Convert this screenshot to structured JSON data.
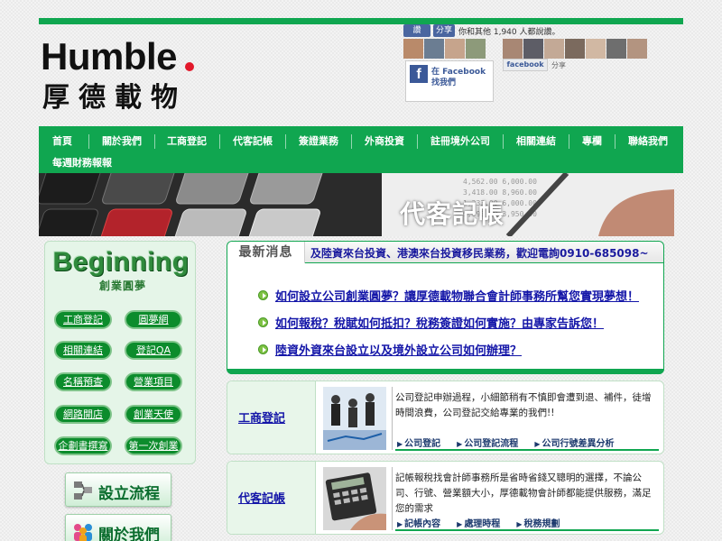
{
  "brand": {
    "name": "Humble",
    "subtitle": "厚德載物"
  },
  "colors": {
    "primary": "#10a650",
    "link": "#1416a8",
    "dot": "#e2182a"
  },
  "facebook": {
    "like_label": "讚",
    "share_label": "分享",
    "count_text": "你和其他 1,940 人都說讚。",
    "find_line1": "在 Facebook",
    "find_line2": "找我們",
    "badge": "facebook",
    "badge_share": "分享"
  },
  "nav": {
    "items": [
      "首頁",
      "關於我們",
      "工商登記",
      "代客記帳",
      "簽證業務",
      "外商投資",
      "註冊境外公司",
      "相關連結",
      "專欄",
      "聯絡我們",
      "每週財務報報"
    ]
  },
  "banner": {
    "text": "代客記帳"
  },
  "sidebar": {
    "title": "Beginning",
    "subtitle": "創業圓夢",
    "buttons": [
      "工商登記",
      "圓夢網",
      "相關連結",
      "登記QA",
      "名稱預查",
      "營業項目",
      "網路開店",
      "創業天使",
      "企劃書撰寫",
      "第一次創業"
    ],
    "big_buttons": [
      "設立流程",
      "關於我們"
    ]
  },
  "news": {
    "tab": "最新消息",
    "marquee": "及陸資來台投資、港澳來台投資移民業務，歡迎電詢0910-685098~",
    "items": [
      "如何設立公司創業圓夢？讓厚德載物聯合會計師事務所幫您實現夢想！",
      "如何報稅？稅賦如何抵扣？稅務簽證如何實施？由專家告訴您！",
      "陸資外資來台設立以及境外設立公司如何辦理？"
    ]
  },
  "services": [
    {
      "title": "工商登記",
      "desc": "公司登記申辦過程，小細節稍有不慎即會遭到退、補件，徒增時間浪費，公司登記交給專業的我們!!",
      "links": [
        "公司登記",
        "公司登記流程",
        "公司行號差異分析"
      ]
    },
    {
      "title": "代客記帳",
      "desc": "記帳報稅找會計師事務所是省時省錢又聰明的選擇，不論公司、行號、營業額大小，厚德載物會計師都能提供服務，滿足您的需求",
      "links": [
        "記帳內容",
        "處理時程",
        "稅務規劃"
      ]
    }
  ]
}
